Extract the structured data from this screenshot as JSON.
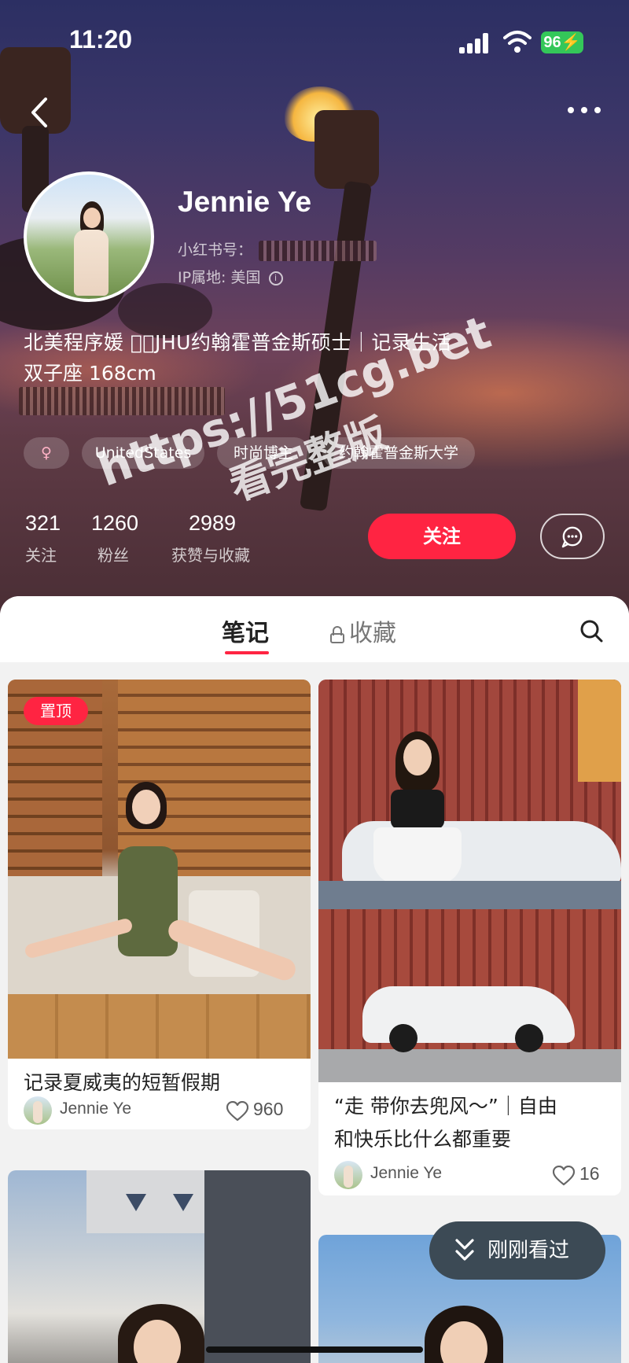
{
  "status_bar": {
    "time": "11:20",
    "battery": "96"
  },
  "profile": {
    "name": "Jennie Ye",
    "id_label": "小红书号：",
    "ip_location": "IP属地: 美国",
    "bio_line1": "北美程序媛 ｜JHU约翰霍普金斯硕士｜记录生活",
    "bio_line2": "双子座 168cm",
    "tags": [
      {
        "label": "♀"
      },
      {
        "label": "UnitedStates"
      },
      {
        "label": "时尚博主"
      },
      {
        "label": "约翰霍普金斯大学"
      }
    ],
    "stats": [
      {
        "value": "321",
        "label": "关注"
      },
      {
        "value": "1260",
        "label": "粉丝"
      },
      {
        "value": "2989",
        "label": "获赞与收藏"
      }
    ],
    "follow_label": "关注"
  },
  "watermark": {
    "line1": "https://51cg.bet",
    "line2": "看完整版"
  },
  "tabs": {
    "notes": "笔记",
    "collections": "收藏"
  },
  "notes": [
    {
      "pinned_label": "置顶",
      "title": "记录夏威夷的短暂假期",
      "author": "Jennie Ye",
      "likes": "960"
    },
    {
      "title_line1": "“走 带你去兜风～”｜自由",
      "title_line2": "和快乐比什么都重要",
      "author": "Jennie Ye",
      "likes": "16"
    }
  ],
  "recently_viewed": "刚刚看过",
  "colors": {
    "accent": "#ff2442",
    "pill_bg": "#3c4a55",
    "battery": "#34c759"
  }
}
